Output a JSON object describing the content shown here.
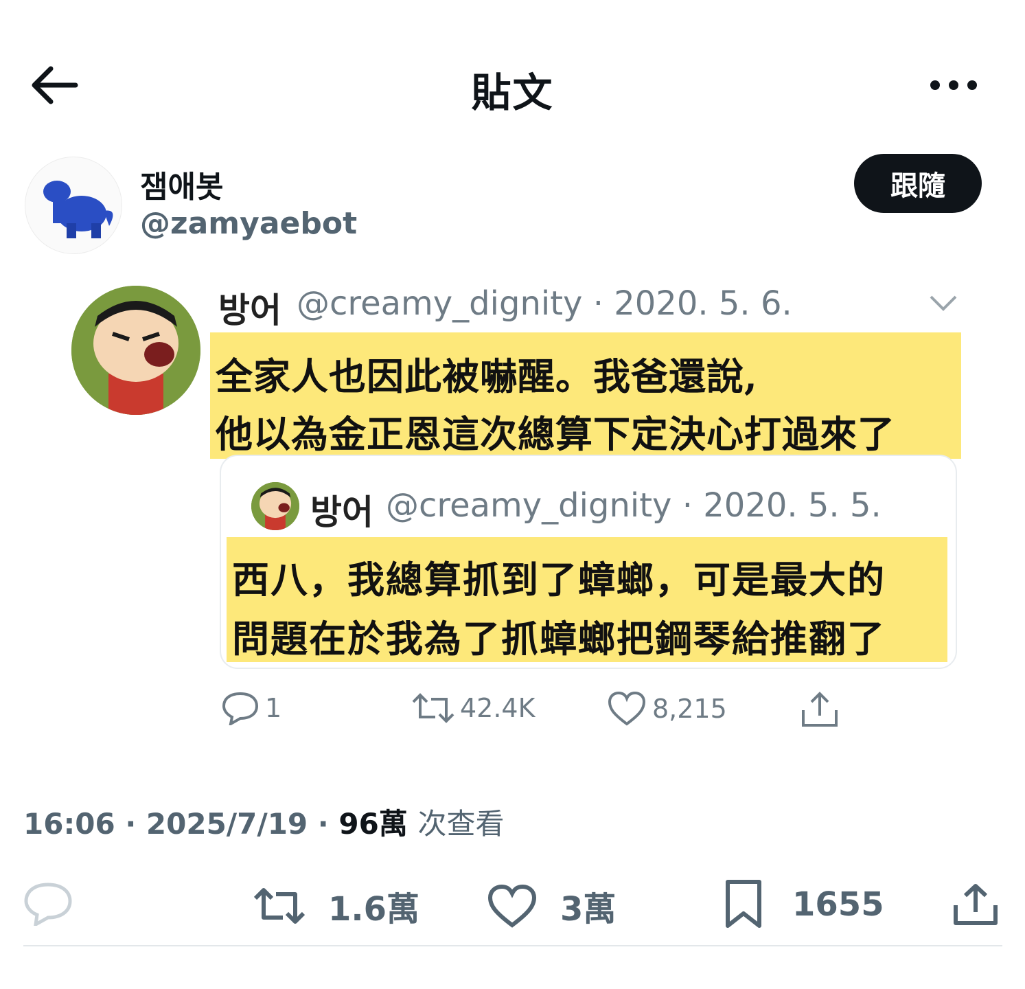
{
  "header": {
    "title": "貼文"
  },
  "author": {
    "name": "잼애봇",
    "handle": "@zamyaebot",
    "follow_label": "跟隨"
  },
  "embedded_tweet": {
    "name": "방어",
    "meta": "@creamy_dignity · 2020. 5. 6.",
    "caption_lines": [
      "全家人也因此被嚇醒。我爸還說,",
      "他以為金正恩這次總算下定決心打過來了"
    ],
    "quoted": {
      "name": "방어",
      "meta": "@creamy_dignity · 2020. 5. 5.",
      "caption_lines": [
        "西八，我總算抓到了蟑螂，可是最大的",
        "問題在於我為了抓蟑螂把鋼琴給推翻了"
      ]
    },
    "stats": {
      "replies": "1",
      "retweets": "42.4K",
      "likes": "8,215"
    }
  },
  "timestamp": {
    "time": "16:06",
    "date": "2025/7/19",
    "views": "96萬",
    "views_label": "次查看"
  },
  "actions": {
    "retweets": "1.6萬",
    "likes": "3萬",
    "bookmarks": "1655"
  },
  "icons": [
    "back-arrow-icon",
    "more-icon",
    "chevron-down-icon",
    "reply-icon",
    "retweet-icon",
    "like-icon",
    "bookmark-icon",
    "share-icon"
  ],
  "colors": {
    "caption_highlight": "#fde87a",
    "follow_button": "#0f1419",
    "muted_text": "#536471"
  }
}
